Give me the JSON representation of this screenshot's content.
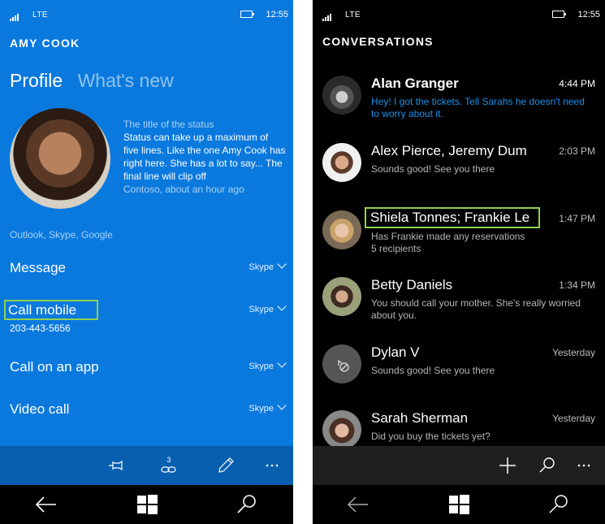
{
  "left_phone": {
    "status_bar": {
      "network": "LTE",
      "time": "12:55"
    },
    "header": "AMY COOK",
    "pivot": {
      "active": "Profile",
      "inactive": "What's new"
    },
    "status_update": {
      "title": "The title of the status",
      "body": "Status can take up a maximum of five lines. Like the one Amy Cook has right here. She has a lot to say... The final line will clip off",
      "meta": "Contoso, about an hour ago"
    },
    "accounts_label": "Outlook, Skype, Google",
    "actions": [
      {
        "label": "Message",
        "service": "Skype"
      },
      {
        "label": "Call mobile",
        "service": "Skype",
        "sub": "203-443-5656"
      },
      {
        "label": "Call on an app",
        "service": "Skype"
      },
      {
        "label": "Video call",
        "service": "Skype"
      }
    ],
    "appbar": {
      "link_count": "3"
    }
  },
  "right_phone": {
    "status_bar": {
      "network": "LTE",
      "time": "12:55"
    },
    "header": "CONVERSATIONS",
    "conversations": [
      {
        "name": "Alan Granger",
        "time": "4:44 PM",
        "message": "Hey! I got the tickets. Tell Sarahs he doesn't need to worry about it.",
        "unread": true
      },
      {
        "name": "Alex Pierce, Jeremy Dum",
        "time": "2:03 PM",
        "message": "Sounds good! See you there"
      },
      {
        "name": "Shiela Tonnes; Frankie Le",
        "time": "1:47 PM",
        "message": "Has Frankie made any reservations",
        "sub": "5 recipients"
      },
      {
        "name": "Betty Daniels",
        "time": "1:34 PM",
        "message": "You should call your mother. She's really worried about you."
      },
      {
        "name": "Dylan V",
        "time": "Yesterday",
        "message": "Sounds good! See you there"
      },
      {
        "name": "Sarah Sherman",
        "time": "Yesterday",
        "message": "Did you buy the tickets yet?"
      }
    ]
  },
  "colors": {
    "accent_blue": "#0a79de",
    "highlight_outline": "#8fd14f",
    "unread_text": "#1e90e8"
  }
}
